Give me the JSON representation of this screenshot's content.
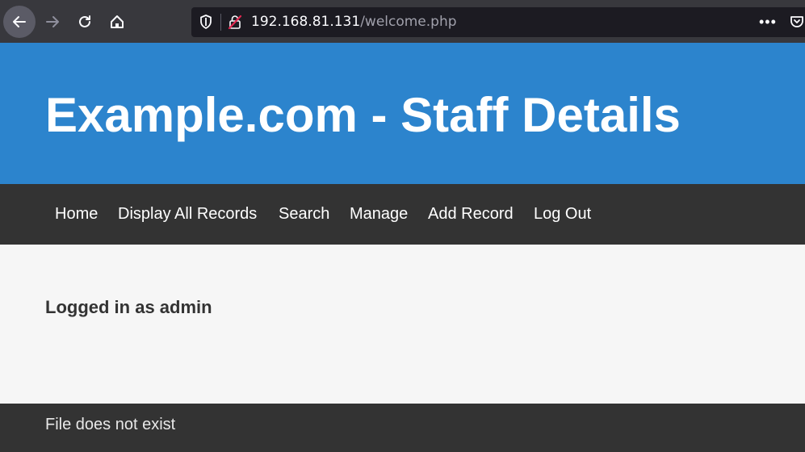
{
  "browser": {
    "url_host": "192.168.81.131",
    "url_path": "/welcome.php",
    "menu_dots": "•••"
  },
  "header": {
    "title": "Example.com - Staff Details"
  },
  "nav": {
    "items": [
      {
        "label": "Home"
      },
      {
        "label": "Display All Records"
      },
      {
        "label": "Search"
      },
      {
        "label": "Manage"
      },
      {
        "label": "Add Record"
      },
      {
        "label": "Log Out"
      }
    ]
  },
  "main": {
    "status": "Logged in as admin"
  },
  "footer": {
    "message": "File does not exist"
  },
  "colors": {
    "header_bg": "#2c84cd",
    "nav_bg": "#333333",
    "content_bg": "#f6f6f6",
    "footer_bg": "#333333",
    "browser_toolbar": "#38383d"
  }
}
